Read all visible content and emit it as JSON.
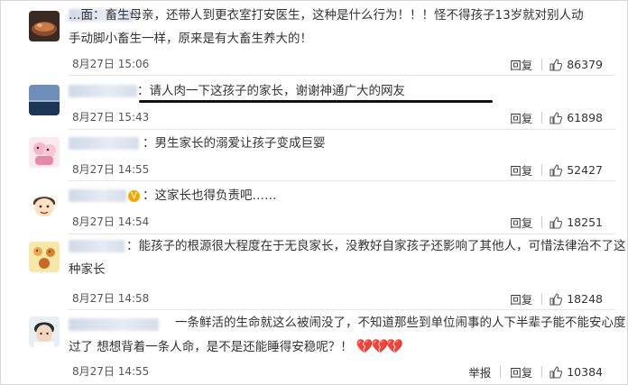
{
  "comments": [
    {
      "line1": "…面：畜生母亲，还带人到更衣室打安医生，这种是什么行为！！！怪不得孩子13岁就对别人动",
      "line2": "手动脚小畜生一样，原来是有大畜生养大的！",
      "time": "8月27日 15:06",
      "reply": "回复",
      "likes": "86379"
    },
    {
      "line1": "：请人肉一下这孩子的家长，谢谢神通广大的网友",
      "time": "8月27日 15:43",
      "reply": "回复",
      "likes": "61898"
    },
    {
      "line1": "：男生家长的溺爱让孩子变成巨婴",
      "time": "8月27日 14:55",
      "reply": "回复",
      "likes": "52427"
    },
    {
      "badge": "V",
      "line1": "：这家长也得负责吧……",
      "time": "8月27日 14:54",
      "reply": "回复",
      "likes": "18251"
    },
    {
      "line1": "：能孩子的根源很大程度在于无良家长，没教好自家孩子还影响了其他人，可惜法律治不了这",
      "line2": "种家长",
      "time": "8月27日 14:58",
      "reply": "回复",
      "likes": "18248"
    },
    {
      "line1": "一条鲜活的生命就这么被闹没了，不知道那些到单位闹事的人下半辈子能不能安心度",
      "line2": "过了 想想背着一条人命，是不是还能睡得安稳呢？！",
      "hearts": "💔💔💔",
      "time": "8月27日 14:55",
      "report": "举报",
      "reply": "回复",
      "likes": "10384"
    }
  ],
  "colors": {
    "underline": "#111111",
    "badge": "#f2a900",
    "heart": "#c0151d"
  }
}
